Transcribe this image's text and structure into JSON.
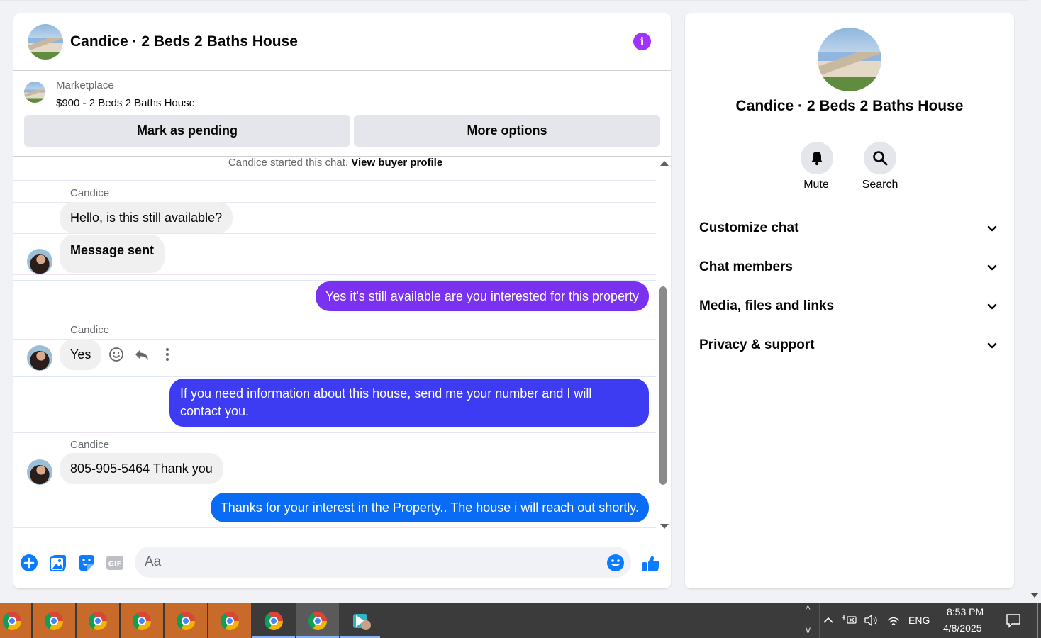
{
  "chat": {
    "title": "Candice · 2 Beds 2 Baths House",
    "marketplace_label": "Marketplace",
    "listing": "$900 - 2 Beds 2 Baths House",
    "pending_button": "Mark as pending",
    "more_button": "More options",
    "started_text": "Candice started this chat.",
    "view_profile": "View buyer profile",
    "messages": [
      {
        "sender": "Candice",
        "text": "Hello, is this still available?"
      },
      {
        "text": "Message sent"
      },
      {
        "text": "Yes it's still available are you interested for this property"
      },
      {
        "sender": "Candice",
        "text": "Yes"
      },
      {
        "text": "If you need information about this house, send me your number and I will contact you."
      },
      {
        "sender": "Candice",
        "text": "805-905-5464 Thank you"
      },
      {
        "text": "Thanks for your interest in the Property.. The house i will reach  out shortly."
      }
    ],
    "colors": {
      "purple": "#7b32f0",
      "indigo": "#3e3cf3",
      "blue": "#0a6cf5",
      "info": "#a033ff"
    },
    "composer_placeholder": "Aa"
  },
  "sidebar": {
    "title": "Candice · 2 Beds 2 Baths House",
    "mute_label": "Mute",
    "search_label": "Search",
    "sections": [
      "Customize chat",
      "Chat members",
      "Media, files and links",
      "Privacy & support"
    ]
  },
  "taskbar": {
    "language": "ENG",
    "time": "8:53 PM",
    "date": "4/8/2025"
  }
}
